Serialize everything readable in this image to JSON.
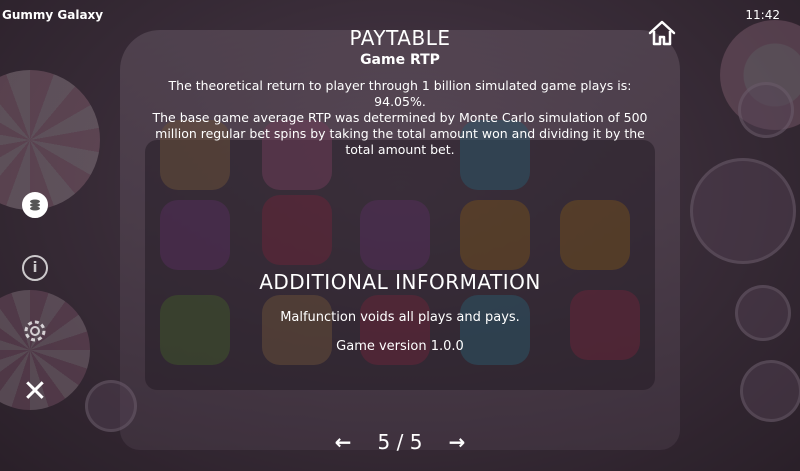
{
  "status_bar": {
    "app_title": "Gummy Galaxy",
    "time": "11:42"
  },
  "side_menu": {
    "close_glyph": "✕"
  },
  "paytable": {
    "title": "PAYTABLE",
    "section_title": "Game RTP",
    "rtp_text": "The theoretical return to player through 1 billion simulated game plays is: 94.05%.",
    "method_text": "The base game average RTP was determined by Monte Carlo simulation of 500 million regular bet spins by taking the total amount won and dividing it by the total amount bet."
  },
  "additional_info": {
    "title": "ADDITIONAL INFORMATION",
    "malfunction_text": "Malfunction voids all plays and pays.",
    "version_text": "Game version 1.0.0"
  },
  "pager": {
    "page_label": "5 / 5",
    "prev_glyph": "←",
    "next_glyph": "→"
  },
  "icons": [
    "coins-icon",
    "info-icon",
    "gear-icon",
    "close-icon",
    "home-icon",
    "prev-arrow-icon",
    "next-arrow-icon",
    "autoplay-icon",
    "spin-icon",
    "fast-forward-icon",
    "bet-stack-icon",
    "mute-icon"
  ],
  "colors": {
    "overlay": "#2a1e28",
    "text": "#ffffff",
    "candy_pink": "#e9a9c2"
  }
}
